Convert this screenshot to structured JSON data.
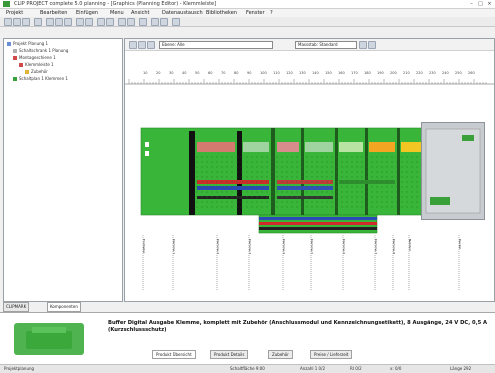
{
  "window": {
    "title": "CLIP PROJECT complete 5.0 planning - [Graphics (Planning Editor) - Klemmleiste]"
  },
  "menu": [
    "Projekt",
    "Bearbeiten",
    "Einfügen",
    "Menu",
    "Ansicht",
    "Datenaustausch",
    "Bibliotheken",
    "Fenster",
    "?"
  ],
  "tree": {
    "items": [
      "Projekt Planung 1",
      "Schaltschrank 1 Planung",
      "Montageschiene 1",
      "Klemmleiste 1",
      "Zubehör",
      "Schaltplan 1 Klemmen 1"
    ]
  },
  "panel_tabs": [
    "CLIPMARK",
    "Komponenten"
  ],
  "editor": {
    "view_combo": "Ebene: Alle",
    "scale_combo": "Massstab: Standard"
  },
  "ruler_labels": [
    "10",
    "20",
    "30",
    "40",
    "50",
    "60",
    "70",
    "80",
    "90",
    "100",
    "110",
    "120",
    "130",
    "140",
    "150",
    "160",
    "170",
    "180",
    "190",
    "200",
    "210",
    "220",
    "230",
    "240",
    "250",
    "260"
  ],
  "component_labels": [
    "Endhalter",
    "Klemme 1",
    "Klemme 2",
    "Klemme 3",
    "Klemme 4",
    "Klemme 5",
    "Klemme 6",
    "Klemme 7",
    "Klemme 8",
    "Netzteil",
    "Deckel"
  ],
  "description": "Buffer Digital Ausgabe Klemme, komplett mit Zubehör (Anschlussmodul und Kennzeichnungsetikett), 8 Ausgänge, 24 V DC, 0,5 A (Kurzschlussschutz)",
  "bottom_tabs": [
    "Produkt Übersicht",
    "Produkt Details",
    "Zubehör",
    "Preise / Lieferzeit"
  ],
  "status": [
    "Projektplanung",
    "Schaltfläche 9:00",
    "Anzahl 1 0/2",
    "RI 0/2",
    "x: 0/0",
    "Länge 292"
  ]
}
